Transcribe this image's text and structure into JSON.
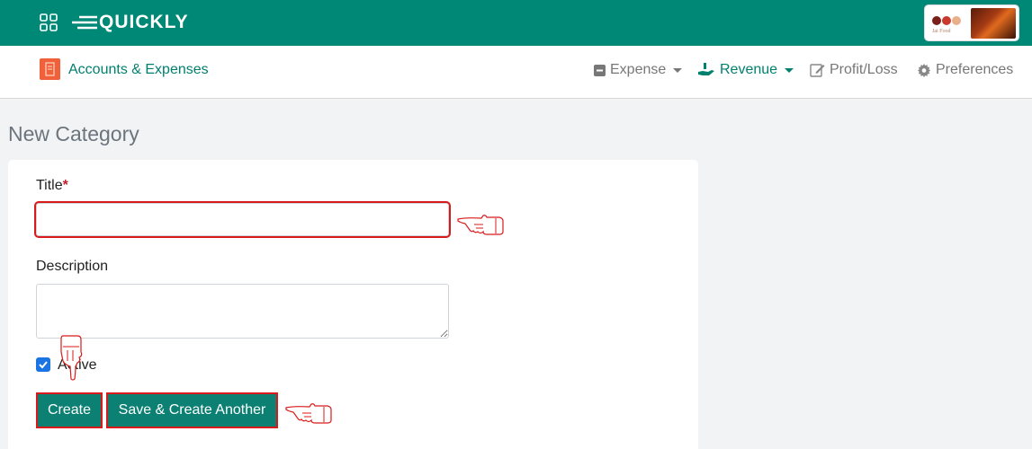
{
  "header": {
    "logo_text": "QUICKLY",
    "brand_tagline": "Jai Food"
  },
  "subnav": {
    "module_title": "Accounts & Expenses",
    "items": [
      {
        "label": "Expense",
        "icon": "minus-square-icon",
        "has_dropdown": true,
        "active": false
      },
      {
        "label": "Revenue",
        "icon": "hand-money-icon",
        "has_dropdown": true,
        "active": true
      },
      {
        "label": "Profit/Loss",
        "icon": "edit-icon",
        "has_dropdown": false,
        "active": false
      },
      {
        "label": "Preferences",
        "icon": "gear-icon",
        "has_dropdown": false,
        "active": false
      }
    ]
  },
  "page": {
    "title": "New Category"
  },
  "form": {
    "title_label": "Title",
    "title_required_mark": "*",
    "title_value": "",
    "description_label": "Description",
    "description_value": "",
    "active_label": "Active",
    "active_checked": true,
    "create_label": "Create",
    "save_another_label": "Save & Create Another"
  },
  "colors": {
    "primary": "#008876",
    "button": "#0d8074",
    "highlight": "#d81a1a",
    "checkbox": "#1b74e4"
  }
}
